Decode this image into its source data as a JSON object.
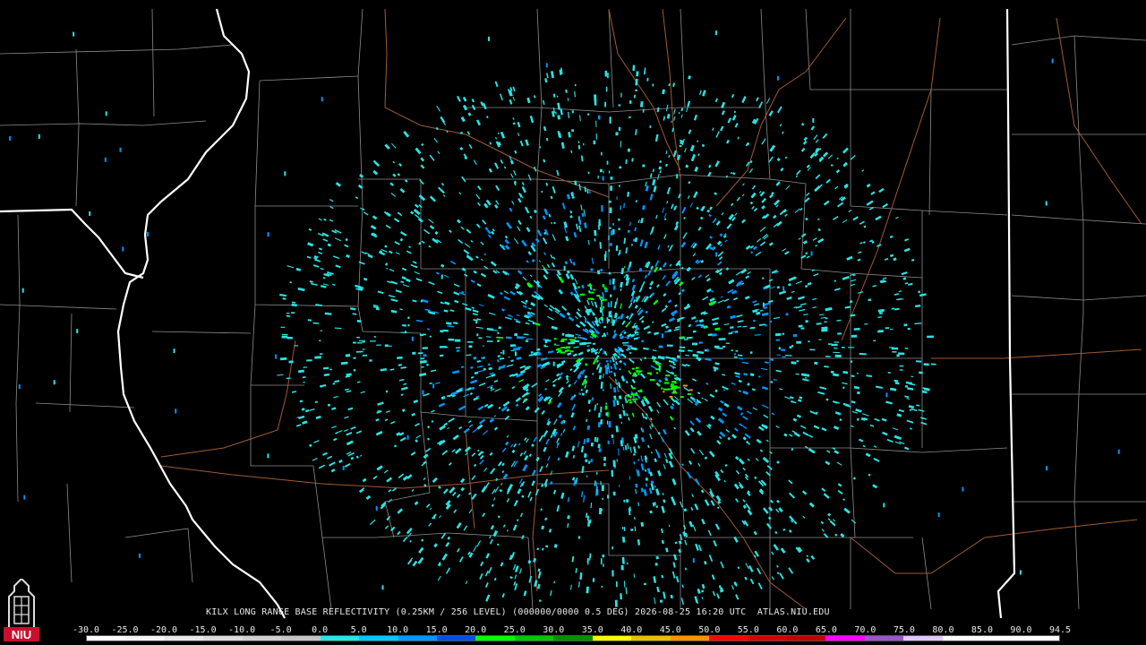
{
  "caption": "KILX LONG RANGE BASE REFLECTIVITY (0.25KM / 256 LEVEL) (000000/0000 0.5 DEG) 2026-08-25 16:20 UTC  ATLAS.NIU.EDU",
  "logo_text": "NIU",
  "scale": {
    "ticks": [
      "-30.0",
      "-25.0",
      "-20.0",
      "-15.0",
      "-10.0",
      "-5.0",
      "0.0",
      "5.0",
      "10.0",
      "15.0",
      "20.0",
      "25.0",
      "30.0",
      "35.0",
      "40.0",
      "45.0",
      "50.0",
      "55.0",
      "60.0",
      "65.0",
      "70.0",
      "75.0",
      "80.0",
      "85.0",
      "90.0",
      "94.5"
    ],
    "colors": [
      "#ffffff",
      "#f4f4f4",
      "#e8e8e8",
      "#dcdcdc",
      "#d0d0d0",
      "#c4c4c4",
      "#29e3e3",
      "#00c8ff",
      "#0096ff",
      "#0050e6",
      "#00ff00",
      "#00c800",
      "#009000",
      "#ffff00",
      "#e6c000",
      "#ff9000",
      "#ff0000",
      "#d60000",
      "#c00000",
      "#ff00ff",
      "#9955c9",
      "#e0c8ff",
      "#ffffff",
      "#ffffff",
      "#ffffff"
    ]
  },
  "colors": {
    "background": "#000000",
    "county_lines": "#8c8c8c",
    "state_lines": "#ffffff",
    "rivers_roads": "#a05a32",
    "echo_low": "#29e3e3",
    "echo_mid": "#0096ff",
    "echo_high": "#00ff00",
    "echo_peak": "#ff9000"
  },
  "icons": {
    "radar_site": "radar-site-dot",
    "logo": "niu-tower-logo"
  }
}
